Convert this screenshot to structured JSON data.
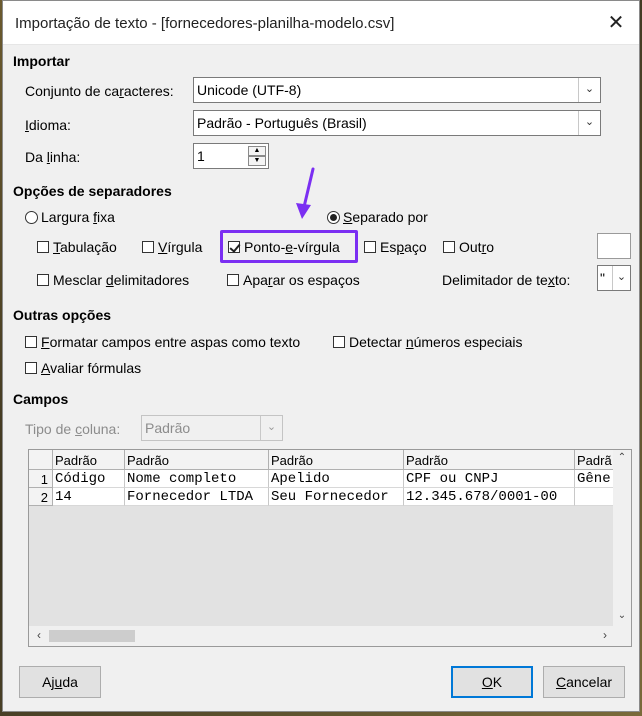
{
  "window": {
    "title": "Importação de texto - [fornecedores-planilha-modelo.csv]"
  },
  "importar": {
    "section": "Importar",
    "charset_label_pre": "Conjunto de ca",
    "charset_label_u": "r",
    "charset_label_post": "acteres:",
    "charset_value": "Unicode (UTF-8)",
    "idioma_label_u": "I",
    "idioma_label_post": "dioma:",
    "idioma_value": "Padrão - Português (Brasil)",
    "linha_label_pre": "Da ",
    "linha_label_u": "l",
    "linha_label_post": "inha:",
    "linha_value": "1"
  },
  "separadores": {
    "section": "Opções de separadores",
    "largura_pre": "Largura ",
    "largura_u": "f",
    "largura_post": "ixa",
    "separado_u": "S",
    "separado_post": "eparado por",
    "tab_u": "T",
    "tab_post": "abulação",
    "virgula_u": "V",
    "virgula_post": "írgula",
    "pv_pre": "Ponto-",
    "pv_u": "e",
    "pv_post": "-vírgula",
    "espaco_pre": "Es",
    "espaco_u": "p",
    "espaco_post": "aço",
    "outro_pre": "Out",
    "outro_u": "r",
    "outro_post": "o",
    "mesclar_pre": "Mesclar ",
    "mesclar_u": "d",
    "mesclar_post": "elimitadores",
    "aparar_pre": "Apa",
    "aparar_u": "r",
    "aparar_post": "ar os espaços",
    "delim_pre": "Delimitador de te",
    "delim_u": "x",
    "delim_post": "to:",
    "delim_value": "\""
  },
  "outras": {
    "section": "Outras opções",
    "formatar_u": "F",
    "formatar_post": "ormatar campos entre aspas como texto",
    "detectar_pre": "Detectar ",
    "detectar_u": "n",
    "detectar_post": "úmeros especiais",
    "avaliar_u": "A",
    "avaliar_post": "valiar fórmulas"
  },
  "campos": {
    "section": "Campos",
    "tipo_pre": "Tipo de ",
    "tipo_u": "c",
    "tipo_post": "oluna:",
    "tipo_value": "Padrão",
    "columns": [
      "Padrão",
      "Padrão",
      "Padrão",
      "Padrão",
      "Padrã"
    ],
    "rows": [
      {
        "num": "1",
        "cells": [
          "Código",
          "Nome completo",
          "Apelido",
          "CPF ou CNPJ",
          "Gêne"
        ]
      },
      {
        "num": "2",
        "cells": [
          "14",
          "Fornecedor LTDA",
          "Seu Fornecedor",
          "12.345.678/0001-00",
          ""
        ]
      }
    ]
  },
  "buttons": {
    "ajuda_pre": "Aj",
    "ajuda_u": "u",
    "ajuda_post": "da",
    "ok_u": "O",
    "ok_post": "K",
    "cancelar_u": "C",
    "cancelar_post": "ancelar"
  },
  "colors": {
    "accent": "#0078d7",
    "annotation": "#7b2ff2"
  }
}
